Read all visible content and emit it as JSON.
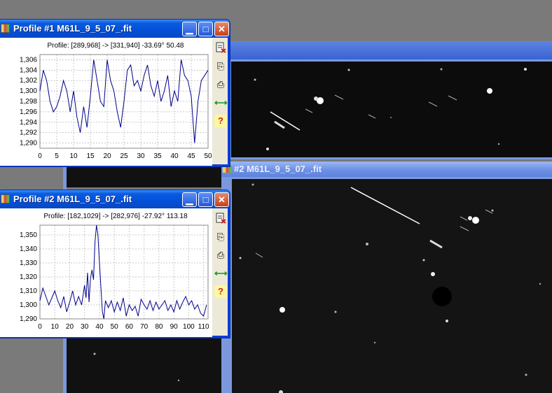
{
  "desktop": {
    "background": "#7a7a7a"
  },
  "image_window_1": {
    "title": ""
  },
  "image_window_2": {
    "title": "#2 M61L_9_5_07_.fit"
  },
  "profile1": {
    "title": "Profile #1 M61L_9_5_07_.fit",
    "caption": "Profile: [289,968] -> [331,940] -33.69°  50.48",
    "buttons": {
      "minimize": "▁",
      "maximize": "□",
      "close": "✕"
    },
    "tools": {
      "copy_icon_glyph": "⎘",
      "print_icon_glyph": "⎙",
      "resize_icon_glyph": "⟷",
      "help_icon_glyph": "?"
    }
  },
  "profile2": {
    "title": "Profile #2 M61L_9_5_07_.fit",
    "caption": "Profile: [182,1029] -> [282,976] -27.92° 113.18",
    "buttons": {
      "minimize": "▁",
      "maximize": "□",
      "close": "✕"
    },
    "tools": {
      "copy_icon_glyph": "⎘",
      "print_icon_glyph": "⎙",
      "resize_icon_glyph": "⟷",
      "help_icon_glyph": "?"
    }
  },
  "chart_data": [
    {
      "type": "line",
      "title": "Profile: [289,968] -> [331,940] -33.69°  50.48",
      "xlim": [
        0,
        50
      ],
      "ylim": [
        1289,
        1307
      ],
      "xticks": [
        0,
        5,
        10,
        15,
        20,
        25,
        30,
        35,
        40,
        45,
        50
      ],
      "yticks": [
        1290,
        1292,
        1294,
        1296,
        1298,
        1300,
        1302,
        1304,
        1306
      ],
      "ytick_labels": [
        "1,290",
        "1,292",
        "1,294",
        "1,296",
        "1,298",
        "1,300",
        "1,302",
        "1,304",
        "1,306"
      ],
      "grid": true,
      "series": [
        {
          "color": "#00008b",
          "x": [
            0,
            1,
            2,
            3,
            4,
            5,
            6,
            7,
            8,
            9,
            10,
            11,
            12,
            13,
            14,
            15,
            16,
            17,
            18,
            19,
            20,
            21,
            22,
            23,
            24,
            25,
            26,
            27,
            28,
            29,
            30,
            31,
            32,
            33,
            34,
            35,
            36,
            37,
            38,
            39,
            40,
            41,
            42,
            43,
            44,
            45,
            46,
            47,
            48,
            49,
            50
          ],
          "values": [
            1300,
            1304,
            1302,
            1298,
            1296,
            1297,
            1299,
            1302,
            1300,
            1296,
            1300,
            1295,
            1292,
            1297,
            1293,
            1299,
            1306,
            1302,
            1298,
            1297,
            1306,
            1302,
            1300,
            1296,
            1293,
            1298,
            1304,
            1305,
            1301,
            1302,
            1300,
            1303,
            1305,
            1301,
            1299,
            1302,
            1298,
            1300,
            1303,
            1297,
            1300,
            1298,
            1306,
            1303,
            1302,
            1299,
            1290,
            1298,
            1302,
            1303,
            1304
          ]
        }
      ]
    },
    {
      "type": "line",
      "title": "Profile: [182,1029] -> [282,976] -27.92° 113.18",
      "xlim": [
        0,
        113
      ],
      "ylim": [
        1290,
        1357
      ],
      "xticks": [
        0,
        10,
        20,
        30,
        40,
        50,
        60,
        70,
        80,
        90,
        100,
        110
      ],
      "yticks": [
        1290,
        1300,
        1310,
        1320,
        1330,
        1340,
        1350
      ],
      "ytick_labels": [
        "1,290",
        "1,300",
        "1,310",
        "1,320",
        "1,330",
        "1,340",
        "1,350"
      ],
      "grid": true,
      "series": [
        {
          "color": "#00008b",
          "x": [
            0,
            2,
            4,
            6,
            8,
            10,
            12,
            14,
            16,
            18,
            20,
            22,
            24,
            26,
            28,
            30,
            31,
            32,
            33,
            34,
            35,
            36,
            37,
            38,
            39,
            40,
            41,
            42,
            43,
            44,
            46,
            48,
            50,
            52,
            54,
            56,
            58,
            60,
            62,
            64,
            66,
            68,
            70,
            72,
            74,
            76,
            78,
            80,
            82,
            84,
            86,
            88,
            90,
            92,
            94,
            96,
            98,
            100,
            102,
            104,
            106,
            108,
            110,
            112
          ],
          "values": [
            1303,
            1312,
            1306,
            1300,
            1305,
            1310,
            1303,
            1298,
            1306,
            1295,
            1302,
            1310,
            1300,
            1306,
            1300,
            1314,
            1305,
            1323,
            1302,
            1319,
            1325,
            1318,
            1345,
            1357,
            1350,
            1330,
            1312,
            1295,
            1290,
            1303,
            1298,
            1303,
            1295,
            1302,
            1296,
            1305,
            1292,
            1300,
            1296,
            1299,
            1292,
            1304,
            1300,
            1297,
            1303,
            1296,
            1302,
            1297,
            1300,
            1303,
            1296,
            1300,
            1295,
            1303,
            1297,
            1302,
            1306,
            1300,
            1303,
            1297,
            1300,
            1294,
            1292,
            1300
          ]
        }
      ]
    }
  ]
}
